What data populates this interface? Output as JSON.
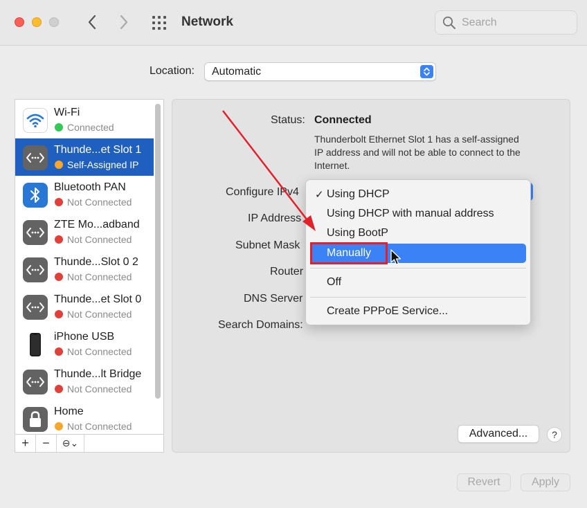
{
  "window": {
    "title": "Network"
  },
  "search": {
    "placeholder": "Search"
  },
  "location": {
    "label": "Location:",
    "value": "Automatic"
  },
  "sidebar": {
    "items": [
      {
        "name": "Wi-Fi",
        "status": "Connected",
        "status_color": "#34c759",
        "icon": "wifi-icon"
      },
      {
        "name": "Thunde...et Slot 1",
        "status": "Self-Assigned IP",
        "status_color": "#f7a72d",
        "icon": "ethernet-icon",
        "selected": true
      },
      {
        "name": "Bluetooth PAN",
        "status": "Not Connected",
        "status_color": "#e0403a",
        "icon": "bluetooth-icon"
      },
      {
        "name": "ZTE Mo...adband",
        "status": "Not Connected",
        "status_color": "#e0403a",
        "icon": "ethernet-icon"
      },
      {
        "name": "Thunde...Slot 0 2",
        "status": "Not Connected",
        "status_color": "#e0403a",
        "icon": "ethernet-icon"
      },
      {
        "name": "Thunde...et Slot 0",
        "status": "Not Connected",
        "status_color": "#e0403a",
        "icon": "ethernet-icon"
      },
      {
        "name": "iPhone USB",
        "status": "Not Connected",
        "status_color": "#e0403a",
        "icon": "iphone-icon"
      },
      {
        "name": "Thunde...lt Bridge",
        "status": "Not Connected",
        "status_color": "#e0403a",
        "icon": "ethernet-icon"
      },
      {
        "name": "Home",
        "status": "Not Connected",
        "status_color": "#f7a72d",
        "icon": "lock-icon"
      }
    ],
    "toolbar": {
      "add": "+",
      "remove": "−",
      "action": "⊖⌄"
    }
  },
  "details": {
    "status_label": "Status:",
    "status_value": "Connected",
    "status_desc": "Thunderbolt Ethernet Slot 1 has a self-assigned IP address and will not be able to connect to the Internet.",
    "configure_label": "Configure IPv4",
    "ip_label": "IP Address",
    "subnet_label": "Subnet Mask",
    "router_label": "Router",
    "dns_label": "DNS Server",
    "search_domains_label": "Search Domains:"
  },
  "menu": {
    "items": [
      {
        "label": "Using DHCP",
        "checked": true
      },
      {
        "label": "Using DHCP with manual address"
      },
      {
        "label": "Using BootP"
      },
      {
        "label": "Manually",
        "highlighted": true
      },
      {
        "label": "Off"
      },
      {
        "label": "Create PPPoE Service..."
      }
    ],
    "check_mark": "✓"
  },
  "buttons": {
    "advanced": "Advanced...",
    "help": "?",
    "revert": "Revert",
    "apply": "Apply"
  },
  "colors": {
    "accent": "#3a82f6",
    "selected_row": "#1f5fbd",
    "annotation": "#e2202a"
  }
}
